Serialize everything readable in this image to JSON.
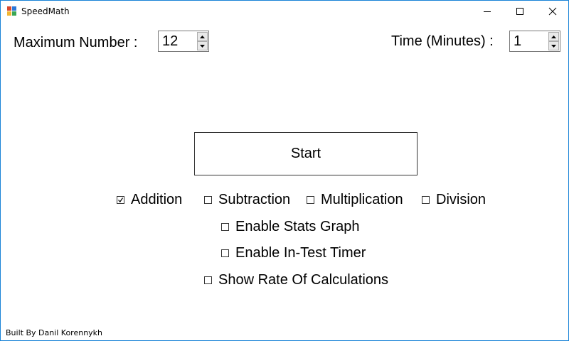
{
  "window": {
    "title": "SpeedMath"
  },
  "settings": {
    "max_number_label": "Maximum Number :",
    "max_number_value": "12",
    "time_label": "Time (Minutes) :",
    "time_value": "1"
  },
  "start_button": {
    "label": "Start"
  },
  "operations": [
    {
      "label": "Addition",
      "checked": true
    },
    {
      "label": "Subtraction",
      "checked": false
    },
    {
      "label": "Multiplication",
      "checked": false
    },
    {
      "label": "Division",
      "checked": false
    }
  ],
  "options": [
    {
      "label": "Enable Stats Graph",
      "checked": false
    },
    {
      "label": "Enable In-Test Timer",
      "checked": false
    },
    {
      "label": "Show Rate Of Calculations",
      "checked": false
    }
  ],
  "footer": {
    "text": "Built By Danil Korennykh"
  },
  "colors": {
    "window_border": "#1883d7",
    "icon_red": "#d9472b",
    "icon_blue": "#2b78d9",
    "icon_yellow": "#f2b632",
    "icon_green": "#3aa655"
  }
}
